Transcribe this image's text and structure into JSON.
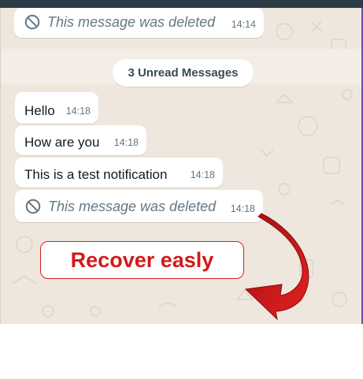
{
  "colors": {
    "chat_background": "#efe7dd",
    "bubble": "#ffffff",
    "timestamp": "#667781",
    "accent_red": "#d11a1a",
    "status_bar": "#2b3a44"
  },
  "messages": [
    {
      "type": "deleted",
      "text": "This message was deleted",
      "time": "14:14",
      "icon": "ban-icon"
    },
    {
      "type": "text",
      "text": "Hello",
      "time": "14:18"
    },
    {
      "type": "text",
      "text": "How are you",
      "time": "14:18"
    },
    {
      "type": "text",
      "text": "This is a test notification",
      "time": "14:18"
    },
    {
      "type": "deleted",
      "text": "This message was deleted",
      "time": "14:18",
      "icon": "ban-icon"
    }
  ],
  "unread_divider": {
    "label": "3 Unread Messages"
  },
  "promo": {
    "label": "Recover easly",
    "arrow_icon": "curved-arrow-icon"
  }
}
